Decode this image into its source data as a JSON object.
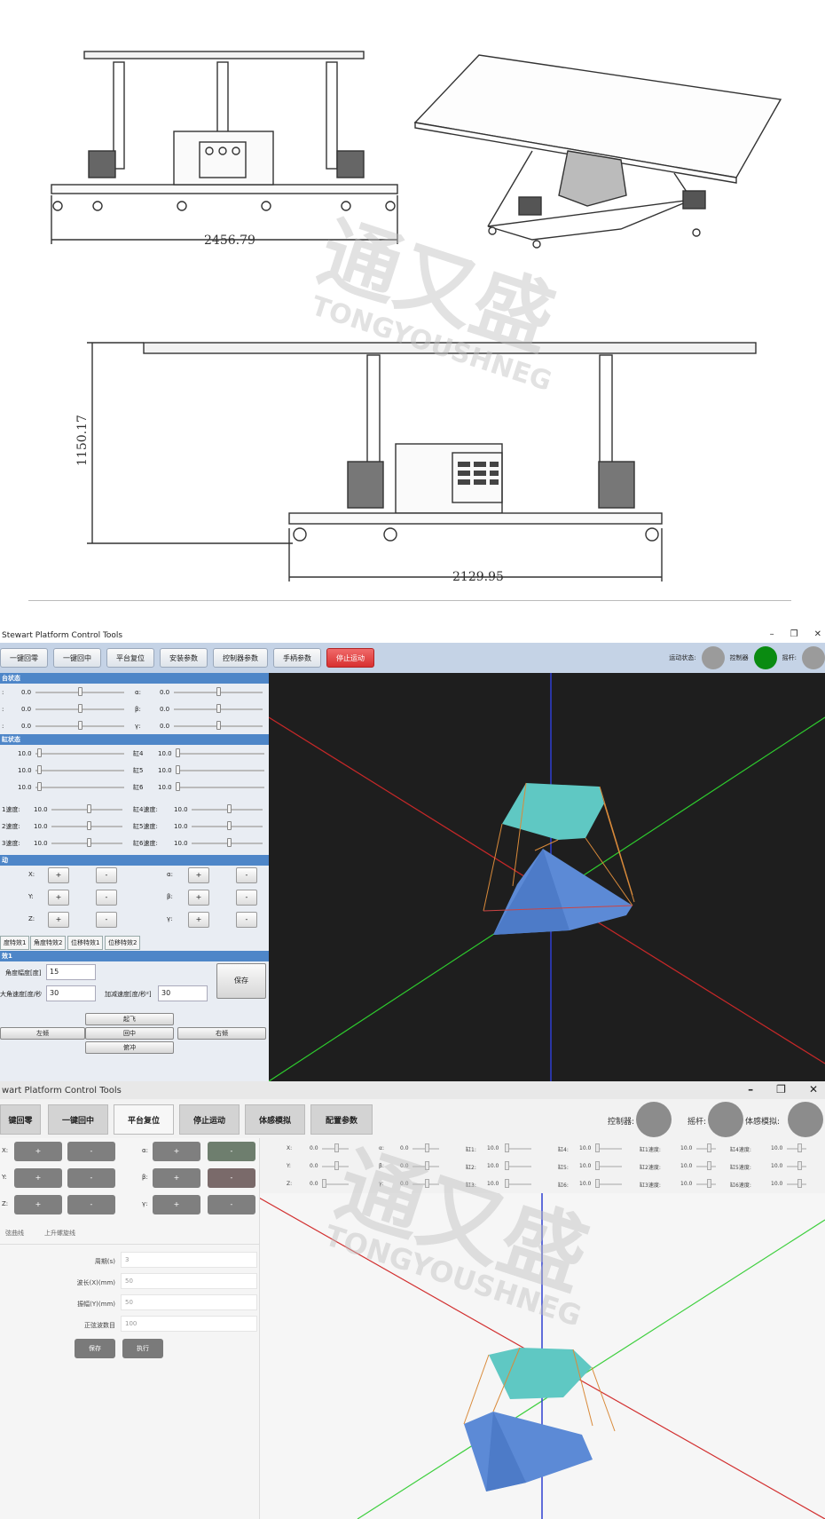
{
  "drawings": {
    "front_width": "2456.79",
    "side_height": "1150.17",
    "side_width": "2129.95"
  },
  "watermark": {
    "cn": "通又盛",
    "en": "TONGYOUSHNEG"
  },
  "window1": {
    "title": "Stewart Platform Control Tools",
    "toolbar": [
      "一键回零",
      "一键回中",
      "平台复位",
      "安装参数",
      "控制器参数",
      "手柄参数",
      "停止运动"
    ],
    "status": {
      "motion_label": "运动状态:",
      "controller_label": "控制器",
      "joystick_label": "摇杆:"
    },
    "section_pose": "台状态",
    "pose_rows": [
      {
        "l1": ":",
        "v1": "0.0",
        "l2": "α:",
        "v2": "0.0"
      },
      {
        "l1": ":",
        "v1": "0.0",
        "l2": "β:",
        "v2": "0.0"
      },
      {
        "l1": ":",
        "v1": "0.0",
        "l2": "γ:",
        "v2": "0.0"
      }
    ],
    "section_cyl": "缸状态",
    "cyl_rows": [
      {
        "v1": "10.0",
        "l2": "缸4",
        "v2": "10.0"
      },
      {
        "v1": "10.0",
        "l2": "缸5",
        "v2": "10.0"
      },
      {
        "v1": "10.0",
        "l2": "缸6",
        "v2": "10.0"
      }
    ],
    "speed_rows": [
      {
        "l1": "1速度:",
        "v1": "10.0",
        "l2": "缸4速度:",
        "v2": "10.0"
      },
      {
        "l1": "2速度:",
        "v1": "10.0",
        "l2": "缸5速度:",
        "v2": "10.0"
      },
      {
        "l1": "3速度:",
        "v1": "10.0",
        "l2": "缸6速度:",
        "v2": "10.0"
      }
    ],
    "section_jog": "动",
    "jog_rows": [
      {
        "l1": "X:",
        "l2": "α:"
      },
      {
        "l1": "Y:",
        "l2": "β:"
      },
      {
        "l1": "Z:",
        "l2": "γ:"
      }
    ],
    "plus": "+",
    "minus": "-",
    "tabs": [
      "度特效1",
      "角度特效2",
      "位移特效1",
      "位移特效2"
    ],
    "section_effect": "效1",
    "angle_label": "角度幅度[度]",
    "angle_value": "15",
    "maxspeed_label": "大角速度[度/秒",
    "maxspeed_value": "30",
    "accel_label": "加减速度[度/秒²]",
    "accel_value": "30",
    "save": "保存",
    "actions": [
      "起飞",
      "左倾",
      "回中",
      "右倾",
      "俯冲"
    ]
  },
  "window2": {
    "title": "wart Platform Control Tools",
    "toolbar": [
      "键回零",
      "一键回中",
      "平台复位",
      "停止运动",
      "体感模拟",
      "配置参数"
    ],
    "status": {
      "controller_label": "控制器:",
      "joystick_label": "摇杆:",
      "motion_label": "体感模拟:"
    },
    "jog_rows": [
      {
        "l1": "X:",
        "l2": "α:"
      },
      {
        "l1": "Y:",
        "l2": "β:"
      },
      {
        "l1": "Z:",
        "l2": "γ:"
      }
    ],
    "plus": "+",
    "minus": "-",
    "pose": [
      {
        "l1": "X:",
        "v1": "0.0",
        "l2": "α:",
        "v2": "0.0"
      },
      {
        "l1": "Y:",
        "v1": "0.0",
        "l2": "β:",
        "v2": "0.0"
      },
      {
        "l1": "Z:",
        "v1": "0.0",
        "l2": "γ:",
        "v2": "0.0"
      }
    ],
    "cyl": [
      {
        "l1": "缸1:",
        "v1": "10.0",
        "l2": "缸4:",
        "v2": "10.0"
      },
      {
        "l1": "缸2:",
        "v1": "10.0",
        "l2": "缸5:",
        "v2": "10.0"
      },
      {
        "l1": "缸3:",
        "v1": "10.0",
        "l2": "缸6:",
        "v2": "10.0"
      }
    ],
    "speed": [
      {
        "l1": "缸1速度:",
        "v1": "10.0",
        "l2": "缸4速度:",
        "v2": "10.0"
      },
      {
        "l1": "缸2速度:",
        "v1": "10.0",
        "l2": "缸5速度:",
        "v2": "10.0"
      },
      {
        "l1": "缸3速度:",
        "v1": "10.0",
        "l2": "缸6速度:",
        "v2": "10.0"
      }
    ],
    "tabs": [
      "弦曲线",
      "上升螺旋线"
    ],
    "fields": [
      {
        "label": "周期(s)",
        "value": "3"
      },
      {
        "label": "波长(X)(mm)",
        "value": "50"
      },
      {
        "label": "振幅(Y)(mm)",
        "value": "50"
      },
      {
        "label": "正弦波数目",
        "value": "100"
      }
    ],
    "save": "保存",
    "run": "执行"
  }
}
